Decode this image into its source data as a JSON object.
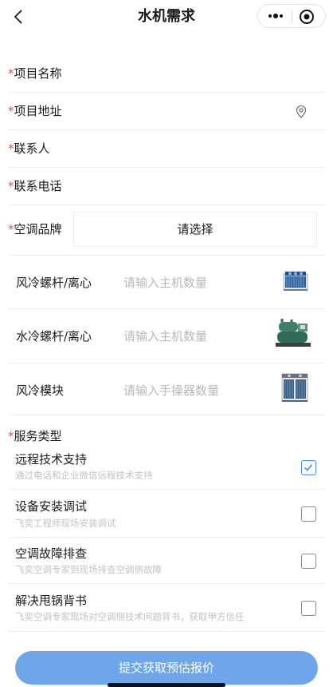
{
  "nav": {
    "title": "水机需求"
  },
  "form": {
    "required_mark": "*",
    "project_name": "项目名称",
    "project_address": "项目地址",
    "contact": "联系人",
    "phone": "联系电话",
    "ac_brand": "空调品牌",
    "ac_brand_select": "请选择"
  },
  "units": [
    {
      "label": "风冷螺杆/离心",
      "placeholder": "请输入主机数量"
    },
    {
      "label": "水冷螺杆/离心",
      "placeholder": "请输入主机数量"
    },
    {
      "label": "风冷模块",
      "placeholder": "请输入手操器数量"
    }
  ],
  "services": {
    "title": "服务类型",
    "items": [
      {
        "title": "远程技术支持",
        "desc": "通过电话和企业微信远程技术支持",
        "checked": true
      },
      {
        "title": "设备安装调试",
        "desc": "飞奕工程师现场安装调试",
        "checked": false
      },
      {
        "title": "空调故障排查",
        "desc": "飞奕空调专家到现场排查空调侧故障",
        "checked": false
      },
      {
        "title": "解决甩锅背书",
        "desc": "飞奕空调专家现场对空调侧技术问题背书，获取甲方信任",
        "checked": false
      }
    ]
  },
  "submit": {
    "label": "提交获取预估报价"
  },
  "colors": {
    "required": "#e64f4f",
    "checkbox_checked": "#4a90e2",
    "submit_bg": "#6fa6ea"
  }
}
